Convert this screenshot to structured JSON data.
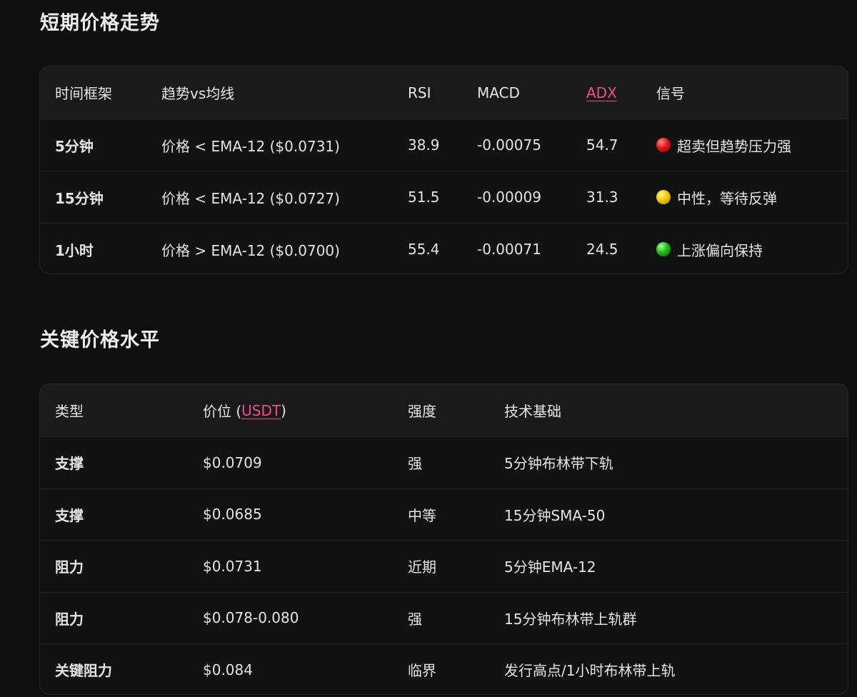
{
  "sections": {
    "trend": {
      "title": "短期价格走势",
      "headers": {
        "timeframe": "时间框架",
        "trend_vs_ma": "趋势vs均线",
        "rsi": "RSI",
        "macd": "MACD",
        "adx": "ADX",
        "signal": "信号"
      },
      "rows": [
        {
          "timeframe": "5分钟",
          "trend": "价格 < EMA-12 ($0.0731)",
          "rsi": "38.9",
          "macd": "-0.00075",
          "adx": "54.7",
          "signal_color": "red",
          "signal_icon": "red-circle-icon",
          "signal": "超卖但趋势压力强"
        },
        {
          "timeframe": "15分钟",
          "trend": "价格 < EMA-12 ($0.0727)",
          "rsi": "51.5",
          "macd": "-0.00009",
          "adx": "31.3",
          "signal_color": "yellow",
          "signal_icon": "yellow-circle-icon",
          "signal": "中性，等待反弹"
        },
        {
          "timeframe": "1小时",
          "trend": "价格 > EMA-12 ($0.0700)",
          "rsi": "55.4",
          "macd": "-0.00071",
          "adx": "24.5",
          "signal_color": "green",
          "signal_icon": "green-circle-icon",
          "signal": "上涨偏向保持"
        }
      ]
    },
    "levels": {
      "title": "关键价格水平",
      "headers": {
        "type": "类型",
        "price_prefix": "价位 (",
        "price_unit": "USDT",
        "price_suffix": ")",
        "strength": "强度",
        "basis": "技术基础"
      },
      "rows": [
        {
          "type": "支撑",
          "price": "$0.0709",
          "strength": "强",
          "basis": "5分钟布林带下轨"
        },
        {
          "type": "支撑",
          "price": "$0.0685",
          "strength": "中等",
          "basis": "15分钟SMA-50"
        },
        {
          "type": "阻力",
          "price": "$0.0731",
          "strength": "近期",
          "basis": "5分钟EMA-12"
        },
        {
          "type": "阻力",
          "price": "$0.078-0.080",
          "strength": "强",
          "basis": "15分钟布林带上轨群"
        },
        {
          "type": "关键阻力",
          "price": "$0.084",
          "strength": "临界",
          "basis": "发行高点/1小时布林带上轨"
        }
      ]
    }
  },
  "colors": {
    "background": "#0f0f0f",
    "card": "#121212",
    "header_row": "#1a1a1a",
    "link": "#ec4f8c",
    "signal_red": "#e01818",
    "signal_yellow": "#f5c800",
    "signal_green": "#22b818"
  }
}
